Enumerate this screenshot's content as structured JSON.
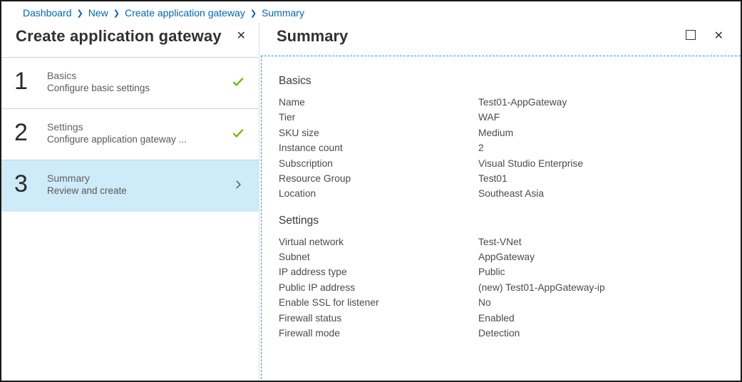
{
  "breadcrumb": [
    "Dashboard",
    "New",
    "Create application gateway",
    "Summary"
  ],
  "left": {
    "title": "Create application gateway",
    "steps": [
      {
        "num": "1",
        "title": "Basics",
        "sub": "Configure basic settings",
        "state": "done"
      },
      {
        "num": "2",
        "title": "Settings",
        "sub": "Configure application gateway ...",
        "state": "done"
      },
      {
        "num": "3",
        "title": "Summary",
        "sub": "Review and create",
        "state": "active"
      }
    ]
  },
  "right": {
    "title": "Summary",
    "sections": [
      {
        "heading": "Basics",
        "rows": [
          {
            "k": "Name",
            "v": "Test01-AppGateway"
          },
          {
            "k": "Tier",
            "v": "WAF"
          },
          {
            "k": "SKU size",
            "v": "Medium"
          },
          {
            "k": "Instance count",
            "v": "2"
          },
          {
            "k": "Subscription",
            "v": "Visual Studio Enterprise"
          },
          {
            "k": "Resource Group",
            "v": "Test01"
          },
          {
            "k": "Location",
            "v": "Southeast Asia"
          }
        ]
      },
      {
        "heading": "Settings",
        "rows": [
          {
            "k": "Virtual network",
            "v": "Test-VNet"
          },
          {
            "k": "Subnet",
            "v": "AppGateway"
          },
          {
            "k": "IP address type",
            "v": "Public"
          },
          {
            "k": "Public IP address",
            "v": "(new) Test01-AppGateway-ip"
          },
          {
            "k": "Enable SSL for listener",
            "v": "No"
          },
          {
            "k": "Firewall status",
            "v": "Enabled"
          },
          {
            "k": "Firewall mode",
            "v": "Detection"
          }
        ]
      }
    ]
  }
}
